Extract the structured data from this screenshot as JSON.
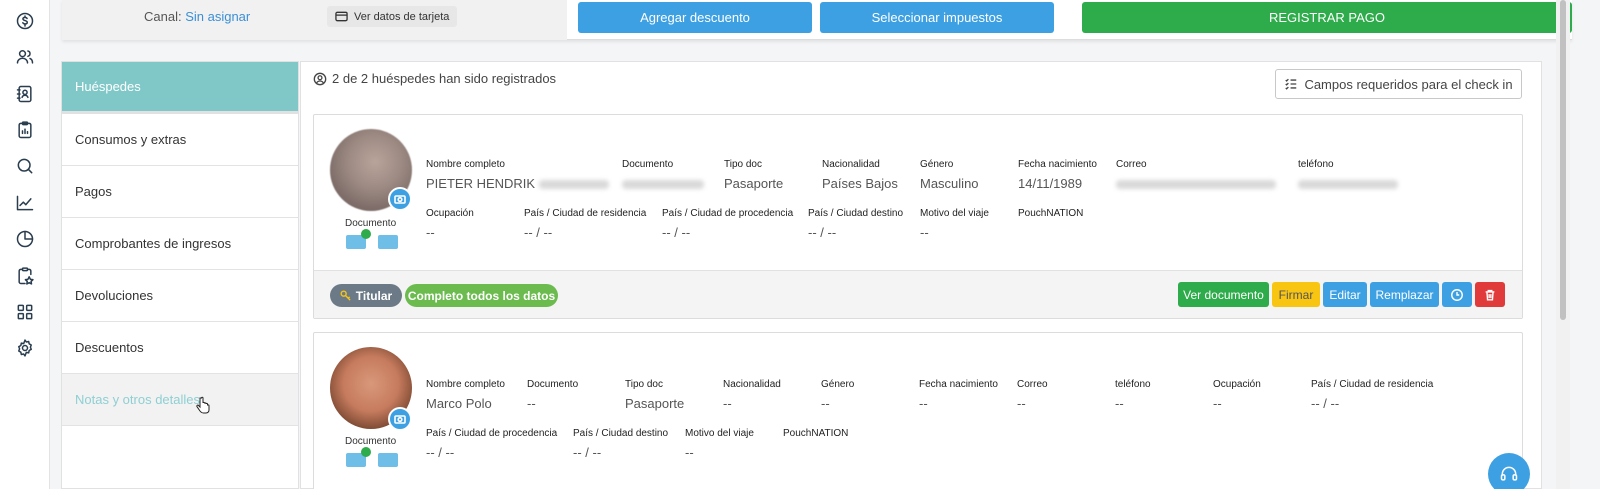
{
  "top": {
    "channel_label": "Canal:",
    "channel_value": "Sin asignar",
    "card_button": "Ver datos de tarjeta",
    "discount_button": "Agregar descuento",
    "tax_button": "Seleccionar impuestos",
    "pay_button": "REGISTRAR PAGO"
  },
  "menu": {
    "items": [
      {
        "label": "Huéspedes"
      },
      {
        "label": "Consumos y extras"
      },
      {
        "label": "Pagos"
      },
      {
        "label": "Comprobantes de ingresos"
      },
      {
        "label": "Devoluciones"
      },
      {
        "label": "Descuentos"
      },
      {
        "label": "Notas y otros detalles"
      }
    ]
  },
  "main": {
    "count_text": "2 de 2 huéspedes han sido registrados",
    "required_button": "Campos requeridos para el check in"
  },
  "guest1": {
    "doc_label": "Documento",
    "labels": {
      "name": "Nombre completo",
      "document": "Documento",
      "doc_type": "Tipo doc",
      "nationality": "Nacionalidad",
      "gender": "Género",
      "birth": "Fecha nacimiento",
      "email": "Correo",
      "phone": "teléfono",
      "occupation": "Ocupación",
      "residence": "País / Ciudad de residencia",
      "origin": "País / Ciudad de procedencia",
      "destination": "País / Ciudad destino",
      "reason": "Motivo del viaje",
      "pouch": "PouchNATION"
    },
    "values": {
      "name": "PIETER HENDRIK",
      "doc_type": "Pasaporte",
      "nationality": "Países Bajos",
      "gender": "Masculino",
      "birth": "14/11/1989",
      "occupation": "--",
      "residence": "-- / --",
      "origin": "-- / --",
      "destination": "-- / --",
      "reason": "--"
    },
    "footer": {
      "titular": "Titular",
      "complete": "Completo todos los datos",
      "view_doc": "Ver documento",
      "sign": "Firmar",
      "edit": "Editar",
      "replace": "Remplazar"
    }
  },
  "guest2": {
    "doc_label": "Documento",
    "labels": {
      "name": "Nombre completo",
      "document": "Documento",
      "doc_type": "Tipo doc",
      "nationality": "Nacionalidad",
      "gender": "Género",
      "birth": "Fecha nacimiento",
      "email": "Correo",
      "phone": "teléfono",
      "occupation": "Ocupación",
      "residence": "País / Ciudad de residencia",
      "origin": "País / Ciudad de procedencia",
      "destination": "País / Ciudad destino",
      "reason": "Motivo del viaje",
      "pouch": "PouchNATION"
    },
    "values": {
      "name": "Marco Polo",
      "document": "--",
      "doc_type": "Pasaporte",
      "nationality": "--",
      "gender": "--",
      "birth": "--",
      "email": "--",
      "phone": "--",
      "occupation": "--",
      "residence": "-- / --",
      "origin": "-- / --",
      "destination": "-- / --",
      "reason": "--"
    }
  },
  "colors": {
    "accent_teal": "#80c8c8",
    "primary_blue": "#3da0e2",
    "success_green": "#2eab4a",
    "warning_yellow": "#f8c513",
    "danger_red": "#e03a3a"
  }
}
